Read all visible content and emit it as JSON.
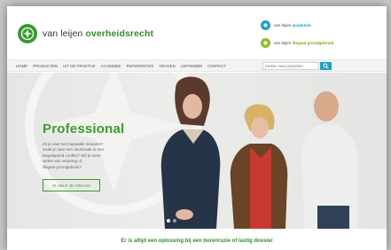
{
  "colors": {
    "brand_green": "#3a9a2e",
    "accent_blue": "#18a3c6"
  },
  "logo": {
    "icon": "brand-logo-icon",
    "light": "van leijen ",
    "strong": "overheidsrecht"
  },
  "sublinks": [
    {
      "prefix": "van leijen ",
      "name": "academie",
      "icon": "academy-icon",
      "color": "#18a3c6"
    },
    {
      "prefix": "van leijen ",
      "name": "illegaal grondgebruik",
      "icon": "land-use-icon",
      "color": "#8cbf26"
    }
  ],
  "nav": [
    "HOME",
    "PRODUCTEN",
    "UIT DE PRAKTIJK",
    "ACADEMIE",
    "REFERENTIES",
    "VRAGEN",
    "LIEFHEBBN",
    "CONTACT"
  ],
  "search": {
    "placeholder": "zoeken naar producten",
    "icon": "search-icon"
  },
  "hero": {
    "title": "Professional",
    "lines": [
      "Zit je vast met bepaalde dossiers?",
      "Snak je naar een doorbraak in een",
      "langslepend conflict? Wil je meer",
      "weten van verjaring of",
      "illegaal grondgebruik?"
    ],
    "button_label": "IK HELP JE GRAAG!",
    "slider_active": 0,
    "slider_count": 2
  },
  "tagline": "Er is altijd een oplossing bij een burenruzie of lastig dossier"
}
